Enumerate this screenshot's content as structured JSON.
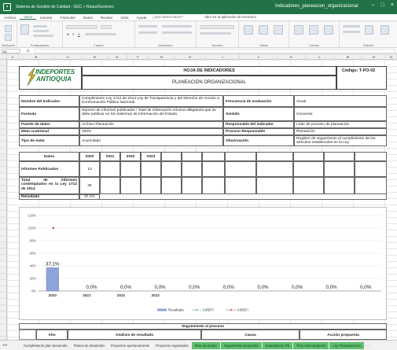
{
  "window": {
    "app_title": "Sistema de Gestión de Calidad - SGC > Rutas/Gestores",
    "doc_title": "Indicadores_planeacion_organizacional"
  },
  "ribbon_tabs": [
    "Archivo",
    "Inicio",
    "Insertar",
    "Fórmulas",
    "Datos",
    "Revisar",
    "Vista",
    "Ayuda"
  ],
  "ribbon_search": "¿Qué desea hacer?",
  "ribbon_share": "Abrir en la aplicación de escritorio",
  "ribbon_groups": [
    "Deshacer",
    "Portapapeles",
    "Fuente",
    "Alineación",
    "Número",
    "Tablas",
    "Celdas",
    "Edición"
  ],
  "columns": [
    "A",
    "B",
    "C",
    "D",
    "E",
    "F",
    "G",
    "H",
    "I",
    "J",
    "K",
    "L",
    "M",
    "N",
    "O"
  ],
  "logo": {
    "line1": "INDEPORTES",
    "line2": "ANTIOQUIA"
  },
  "header": {
    "title": "HOJA DE INDICADORES",
    "subtitle": "PLANEACIÓN ORGANIZACIONAL",
    "code": "Código: T-PO-02"
  },
  "info": [
    {
      "label": "Nombre del Indicador",
      "value": "Cumplimiento Ley 1712 de 2014 Ley de Transparencia y del Derecho de Acceso a la Información Pública Nacional",
      "label2": "Frecuencia de evaluación",
      "value2": "Anual"
    },
    {
      "label": "Formula",
      "value": "Número de informes publicados / Total de información mínima obligatoria que se debe publicar en los Sistemas de Información del Estado",
      "label2": "Sentido",
      "value2": "Creciente"
    },
    {
      "label": "Fuente de datos",
      "value": "Archivo Planeación",
      "label2": "Responsable del indicador",
      "value2": "Líder de proceso de planeación"
    },
    {
      "label": "Meta cuatrienal",
      "value": "100%",
      "label2": "Proceso Responsable",
      "value2": "Planeación"
    },
    {
      "label": "Tipo de meta",
      "value": "Acumulado",
      "label2": "Observación",
      "value2": "Registro de seguimiento al cumplimiento de los artículos establecidos en la Ley"
    }
  ],
  "data_table": {
    "header": "Datos",
    "years": [
      "2020",
      "2021",
      "2022",
      "2023"
    ],
    "rows": [
      {
        "label": "Informes Publicados",
        "value": "13"
      },
      {
        "label": "Total de informes contemplados en la Ley 1712 de 2014",
        "value": "35"
      },
      {
        "label": "Resultado",
        "value": "37,1%"
      }
    ]
  },
  "chart_data": {
    "type": "bar",
    "categories": [
      "2020",
      "2021",
      "2022",
      "2023"
    ],
    "value_labels": [
      "37,1%",
      "0,0%",
      "0,0%",
      "0,0%",
      "0,0%",
      "0,0%",
      "0,0%",
      "0,0%",
      "0,0%",
      "0,0%"
    ],
    "series": [
      {
        "name": "Resultado",
        "values": [
          37.1,
          0,
          0,
          0
        ],
        "color": "#8ea3d8"
      },
      {
        "name": "#¡REF!",
        "values": [],
        "color": "#4a9e6a"
      },
      {
        "name": "#¡REF!",
        "values": [
          100
        ],
        "color": "#c0392b"
      }
    ],
    "yticks": [
      "0%",
      "20%",
      "40%",
      "60%",
      "80%",
      "100%",
      "120%"
    ],
    "ylim": [
      0,
      120
    ],
    "legend": "bottom",
    "grid": true
  },
  "followup": {
    "title": "Seguimiento al proceso",
    "columns": [
      "Año",
      "Análisis de resultado",
      "Causa",
      "Acción propuesta"
    ]
  },
  "sheet_tabs": [
    {
      "label": "Cumplimiento plan desarrollo",
      "active": false
    },
    {
      "label": "Planes de desarrollo",
      "active": false
    },
    {
      "label": "Proyectos oportunamente",
      "active": false
    },
    {
      "label": "Proyectos registrados",
      "active": false
    },
    {
      "label": "Plan de acción",
      "active": true
    },
    {
      "label": "Seguimiento proyectos",
      "active": true
    },
    {
      "label": "Seguimiento PE",
      "active": true
    },
    {
      "label": "Plan Anticorrupción",
      "active": true
    },
    {
      "label": "Ley Transparencia",
      "active": true
    }
  ],
  "colors": {
    "excel_green": "#217346",
    "tab_green": "#5fbf6e",
    "logo_green": "#1d7a3a"
  }
}
